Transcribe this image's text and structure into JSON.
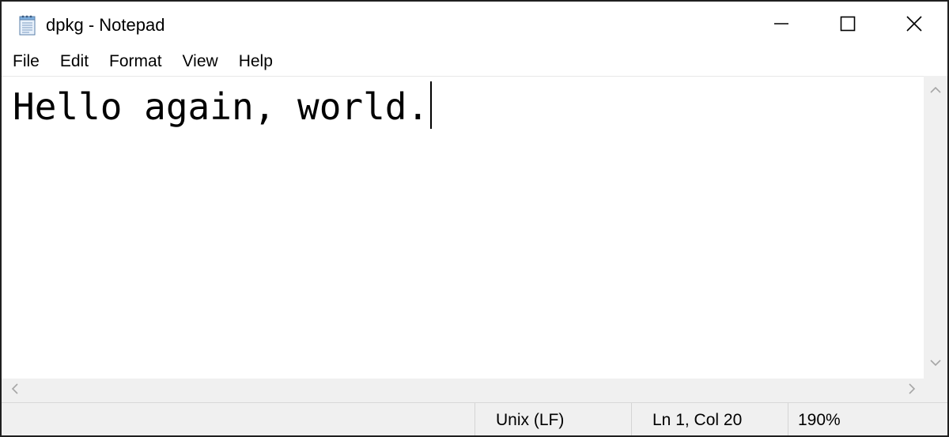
{
  "window": {
    "title": "dpkg - Notepad",
    "app_icon": "notepad-icon",
    "controls": {
      "minimize_icon": "minimize-icon",
      "maximize_icon": "maximize-icon",
      "close_icon": "close-icon"
    }
  },
  "menu": {
    "items": [
      {
        "label": "File"
      },
      {
        "label": "Edit"
      },
      {
        "label": "Format"
      },
      {
        "label": "View"
      },
      {
        "label": "Help"
      }
    ]
  },
  "editor": {
    "content": "Hello again, world."
  },
  "status": {
    "line_ending": "Unix (LF)",
    "position": "Ln 1, Col 20",
    "zoom": "190%"
  },
  "colors": {
    "window_background": "#ffffff",
    "chrome_background": "#f0f0f0",
    "text": "#000000"
  }
}
